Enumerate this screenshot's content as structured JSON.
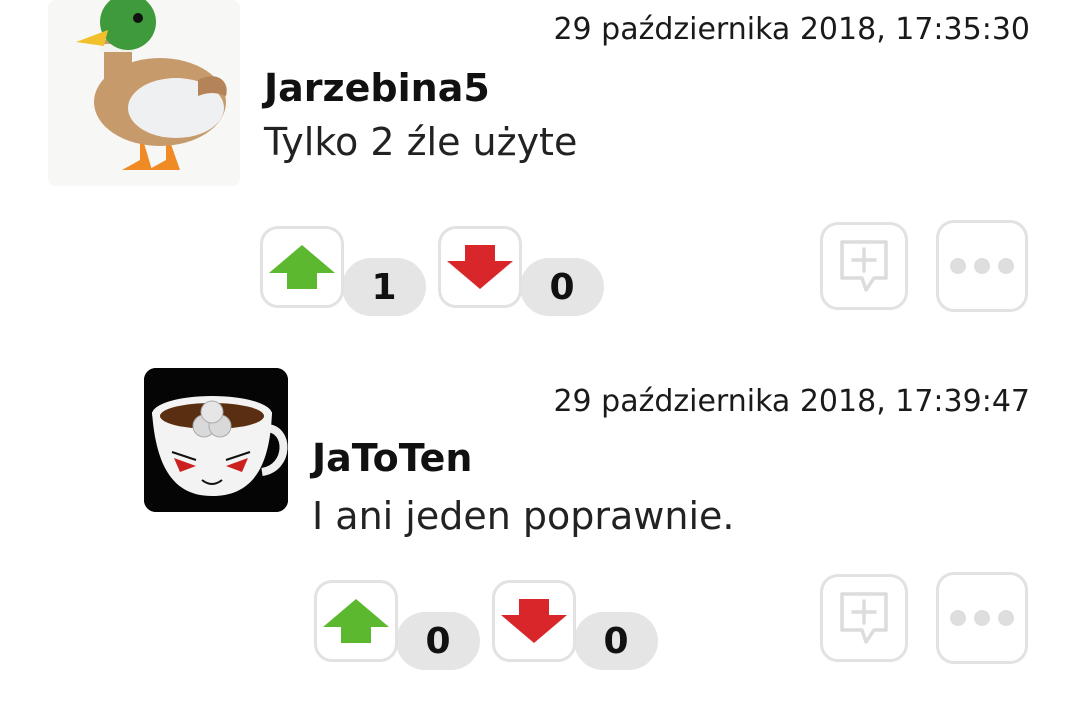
{
  "comments": [
    {
      "timestamp": "29 października 2018, 17:35:30",
      "author": "Jarzebina5",
      "text": "Tylko 2 źle użyte",
      "upvotes": "1",
      "downvotes": "0",
      "avatar": "duck-avatar"
    },
    {
      "timestamp": "29 października 2018, 17:39:47",
      "author": "JaToTen",
      "text": "I ani jeden poprawnie.",
      "upvotes": "0",
      "downvotes": "0",
      "avatar": "teacup-face-avatar"
    }
  ],
  "icons": {
    "upvote": "up-arrow-icon",
    "downvote": "down-arrow-icon",
    "reply": "reply-plus-icon",
    "more": "more-dots-icon"
  },
  "colors": {
    "upvote": "#5cb82f",
    "downvote": "#d8262b",
    "border": "#e2e2e2",
    "pill": "#e5e5e5"
  }
}
